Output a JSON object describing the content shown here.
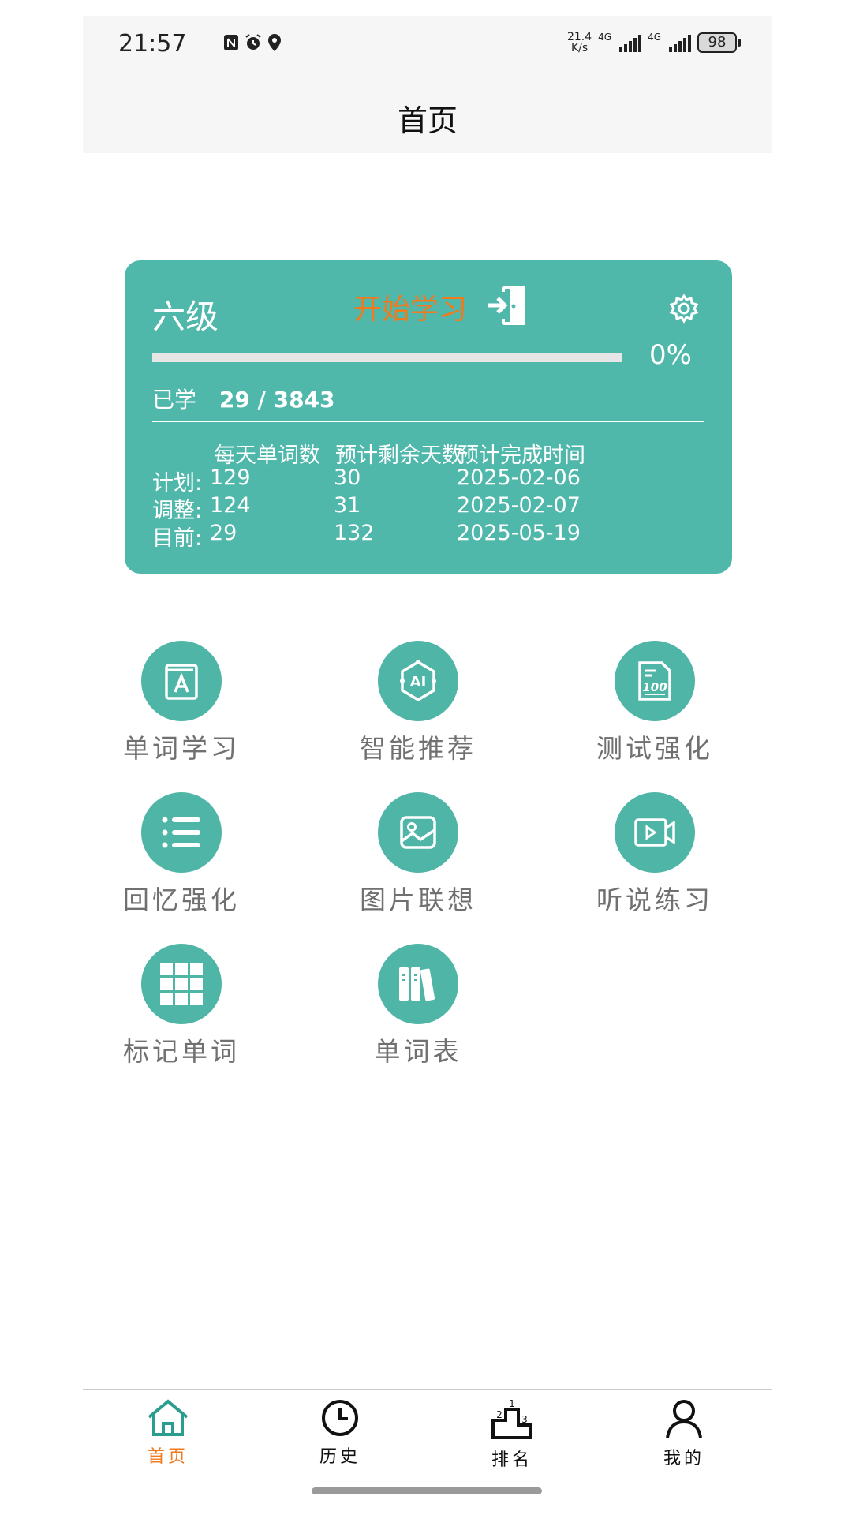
{
  "status_bar": {
    "time": "21:57",
    "net_speed_value": "21.4",
    "net_speed_unit": "K/s",
    "network_label_1": "4G",
    "network_label_2": "4G",
    "battery": "98"
  },
  "header": {
    "title": "首页"
  },
  "card": {
    "level": "六级",
    "start_label": "开始学习",
    "progress_percent": 0,
    "percent_label": "0%",
    "learned_label": "已学",
    "learned_value": "29 / 3843",
    "table_headers": [
      "每天单词数",
      "预计剩余天数",
      "预计完成时间"
    ],
    "rows": [
      {
        "label": "计划:",
        "daily": "129",
        "days_left": "30",
        "finish_date": "2025-02-06"
      },
      {
        "label": "调整:",
        "daily": "124",
        "days_left": "31",
        "finish_date": "2025-02-07"
      },
      {
        "label": "目前:",
        "daily": "29",
        "days_left": "132",
        "finish_date": "2025-05-19"
      }
    ],
    "accent_color": "#50b7ab",
    "start_color": "#f07a1e"
  },
  "features": [
    {
      "label": "单词学习",
      "icon": "book-a-icon"
    },
    {
      "label": "智能推荐",
      "icon": "ai-chip-icon"
    },
    {
      "label": "测试强化",
      "icon": "test-paper-100-icon"
    },
    {
      "label": "回忆强化",
      "icon": "list-icon"
    },
    {
      "label": "图片联想",
      "icon": "image-icon"
    },
    {
      "label": "听说练习",
      "icon": "video-play-icon"
    },
    {
      "label": "标记单词",
      "icon": "grid-icon"
    },
    {
      "label": "单词表",
      "icon": "bookshelf-icon"
    }
  ],
  "bottom_nav": [
    {
      "label": "首页",
      "icon": "home-icon",
      "active": true
    },
    {
      "label": "历史",
      "icon": "clock-icon",
      "active": false
    },
    {
      "label": "排名",
      "icon": "podium-icon",
      "active": false
    },
    {
      "label": "我的",
      "icon": "person-icon",
      "active": false
    }
  ],
  "colors": {
    "tile_circle": "#4fb5a7",
    "nav_active": "#f07a1e",
    "nav_icon_active": "#2a9d8f"
  }
}
